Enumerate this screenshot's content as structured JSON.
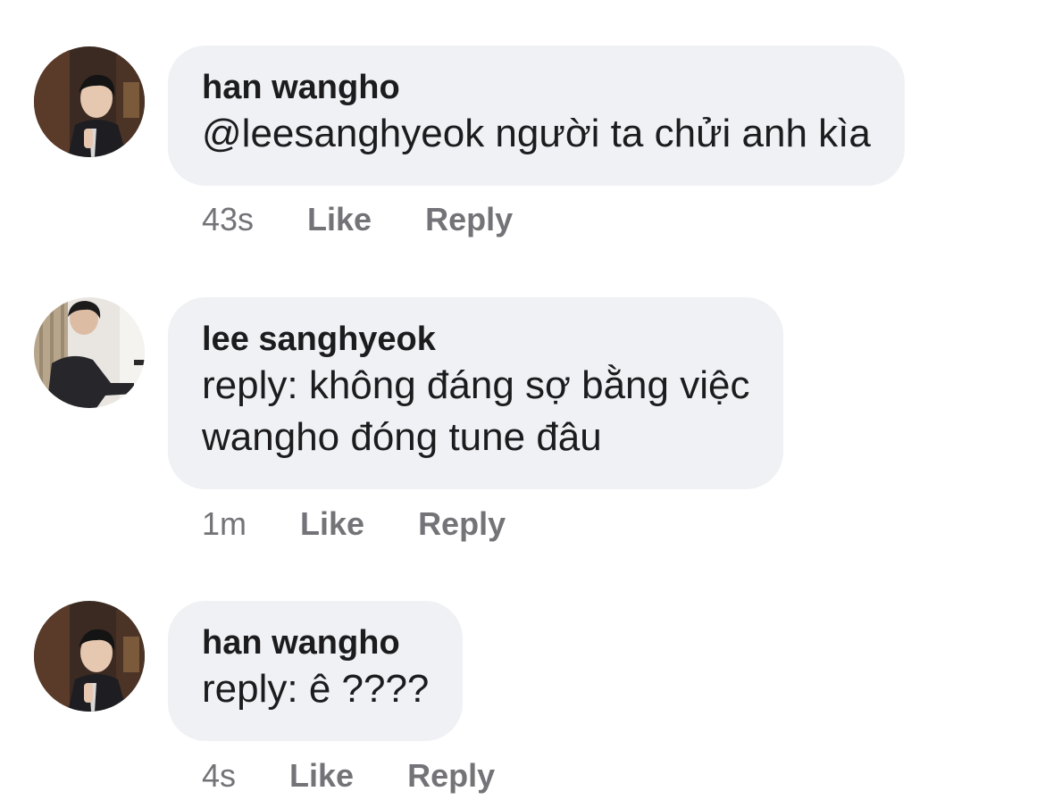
{
  "comments": [
    {
      "author": "han wangho",
      "lines": [
        "@leesanghyeok người ta chửi anh kìa"
      ],
      "time": "43s",
      "like_label": "Like",
      "reply_label": "Reply",
      "avatar": "profile-photo-suit"
    },
    {
      "author": "lee sanghyeok",
      "lines": [
        "reply: không đáng sợ bằng việc",
        "wangho đóng tune đâu"
      ],
      "time": "1m",
      "like_label": "Like",
      "reply_label": "Reply",
      "avatar": "profile-photo-piano"
    },
    {
      "author": "han wangho",
      "lines": [
        "reply: ê ????"
      ],
      "time": "4s",
      "like_label": "Like",
      "reply_label": "Reply",
      "avatar": "profile-photo-suit"
    }
  ],
  "colors": {
    "bubble": "#f0f1f4",
    "text": "#1c1c1e",
    "meta": "#737378"
  }
}
